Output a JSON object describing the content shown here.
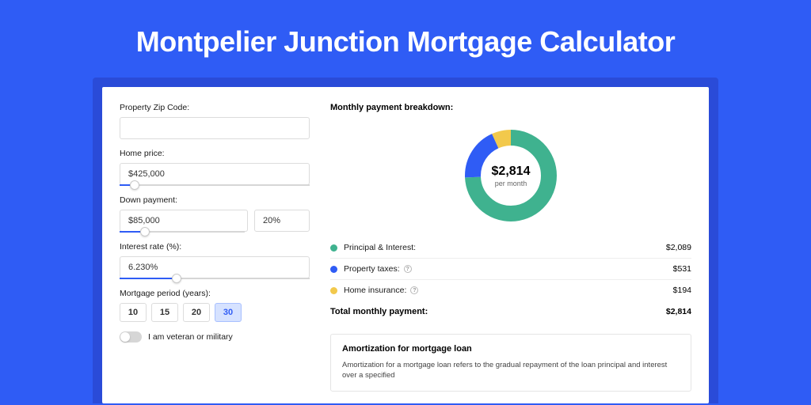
{
  "title": "Montpelier Junction Mortgage Calculator",
  "form": {
    "zip_label": "Property Zip Code:",
    "zip_value": "",
    "homeprice_label": "Home price:",
    "homeprice_value": "$425,000",
    "homeprice_slider_pct": 8,
    "downpay_label": "Down payment:",
    "downpay_value": "$85,000",
    "downpay_pct_value": "20%",
    "downpay_slider_pct": 20,
    "rate_label": "Interest rate (%):",
    "rate_value": "6.230%",
    "rate_slider_pct": 30,
    "period_label": "Mortgage period (years):",
    "periods": [
      "10",
      "15",
      "20",
      "30"
    ],
    "period_active": "30",
    "veteran_label": "I am veteran or military",
    "veteran_on": false
  },
  "breakdown": {
    "title": "Monthly payment breakdown:",
    "total": "$2,814",
    "per_month": "per month",
    "items": [
      {
        "label": "Principal & Interest:",
        "value": "$2,089",
        "color": "#3fb28f",
        "info": false,
        "pct": 74.2
      },
      {
        "label": "Property taxes:",
        "value": "$531",
        "color": "#2f5cf5",
        "info": true,
        "pct": 18.9
      },
      {
        "label": "Home insurance:",
        "value": "$194",
        "color": "#f2c94c",
        "info": true,
        "pct": 6.9
      }
    ],
    "total_label": "Total monthly payment:",
    "total_value": "$2,814"
  },
  "amort": {
    "title": "Amortization for mortgage loan",
    "text": "Amortization for a mortgage loan refers to the gradual repayment of the loan principal and interest over a specified"
  },
  "chart_data": {
    "type": "pie",
    "title": "Monthly payment breakdown",
    "series": [
      {
        "name": "Principal & Interest",
        "value": 2089,
        "pct": 74.2,
        "color": "#3fb28f"
      },
      {
        "name": "Property taxes",
        "value": 531,
        "pct": 18.9,
        "color": "#2f5cf5"
      },
      {
        "name": "Home insurance",
        "value": 194,
        "pct": 6.9,
        "color": "#f2c94c"
      }
    ],
    "total": 2814,
    "unit": "USD/month"
  }
}
